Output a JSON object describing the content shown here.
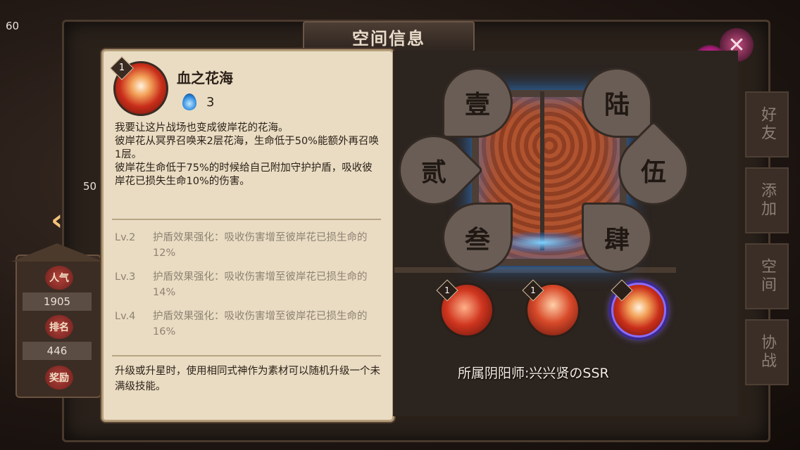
{
  "header": {
    "title": "空间信息",
    "corner_num_top": "60",
    "corner_num_mid": "50"
  },
  "skill_panel": {
    "level": "1",
    "name": "血之花海",
    "cost": "3",
    "description": "我要让这片战场也变成彼岸花的花海。\n彼岸花从冥界召唤来2层花海，生命低于50%能额外再召唤1层。\n彼岸花生命低于75%的时候给自己附加守护护盾，吸收彼岸花已损失生命10%的伤害。",
    "levels": [
      {
        "lv": "Lv.2",
        "text": "护盾效果强化：吸收伤害增至彼岸花已损生命的12%"
      },
      {
        "lv": "Lv.3",
        "text": "护盾效果强化：吸收伤害增至彼岸花已损生命的14%"
      },
      {
        "lv": "Lv.4",
        "text": "护盾效果强化：吸收伤害增至彼岸花已损生命的16%"
      }
    ],
    "footer": "升级或升星时，使用相同式神作为素材可以随机升级一个未满级技能。"
  },
  "left_widget": {
    "popularity_label": "人气",
    "popularity_value": "1905",
    "rank_label": "排名",
    "rank_value": "446",
    "reward_label": "奖励"
  },
  "petals": {
    "p1": "壹",
    "p2": "贰",
    "p3": "叁",
    "p4": "肆",
    "p5": "伍",
    "p6": "陆"
  },
  "skills": [
    {
      "level": "1"
    },
    {
      "level": "1"
    },
    {
      "level": ""
    }
  ],
  "owner": "所属阴阳师:兴兴贤のSSR",
  "right_tabs": [
    "好友",
    "添加",
    "空间",
    "协战"
  ],
  "close_symbol": "✕",
  "colors": {
    "accent": "#8a6cff",
    "parchment": "#e9dcc3",
    "door_glow": "#2b7bd6"
  }
}
